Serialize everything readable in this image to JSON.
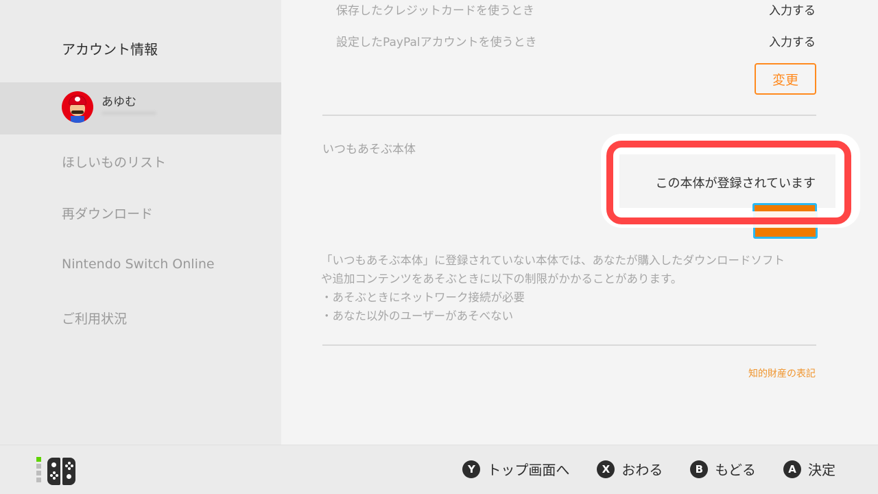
{
  "sidebar": {
    "title": "アカウント情報",
    "user": {
      "name": "あゆむ",
      "email_obscured": true
    },
    "items": [
      {
        "label": "ほしいものリスト"
      },
      {
        "label": "再ダウンロード"
      },
      {
        "label": "Nintendo Switch Online"
      },
      {
        "label": "ご利用状況"
      }
    ]
  },
  "main": {
    "password_rows": [
      {
        "label": "保存したクレジットカードを使うとき",
        "value": "入力する"
      },
      {
        "label": "設定したPayPalアカウントを使うとき",
        "value": "入力する"
      }
    ],
    "change_button": "変更",
    "primary_console": {
      "title": "いつもあそぶ本体",
      "status": "この本体が登録されています",
      "description_lines": [
        "「いつもあそぶ本体」に登録されていない本体では、あなたが購入したダウンロードソフト",
        "や追加コンテンツをあそぶときに以下の制限がかかることがあります。",
        "・あそぶときにネットワーク接続が必要",
        "・あなた以外のユーザーがあそべない"
      ]
    },
    "ip_notice_link": "知的財産の表記"
  },
  "footer": {
    "player_indicator": {
      "active_player": 1,
      "total": 4
    },
    "hints": [
      {
        "button": "Y",
        "label": "トップ画面へ"
      },
      {
        "button": "X",
        "label": "おわる"
      },
      {
        "button": "B",
        "label": "もどる"
      },
      {
        "button": "A",
        "label": "決定"
      }
    ]
  },
  "colors": {
    "accent_orange": "#ff8a1e",
    "focus_blue": "#2bb8f2",
    "highlight_red": "#ff4545",
    "player_led_on": "#5ed400"
  }
}
